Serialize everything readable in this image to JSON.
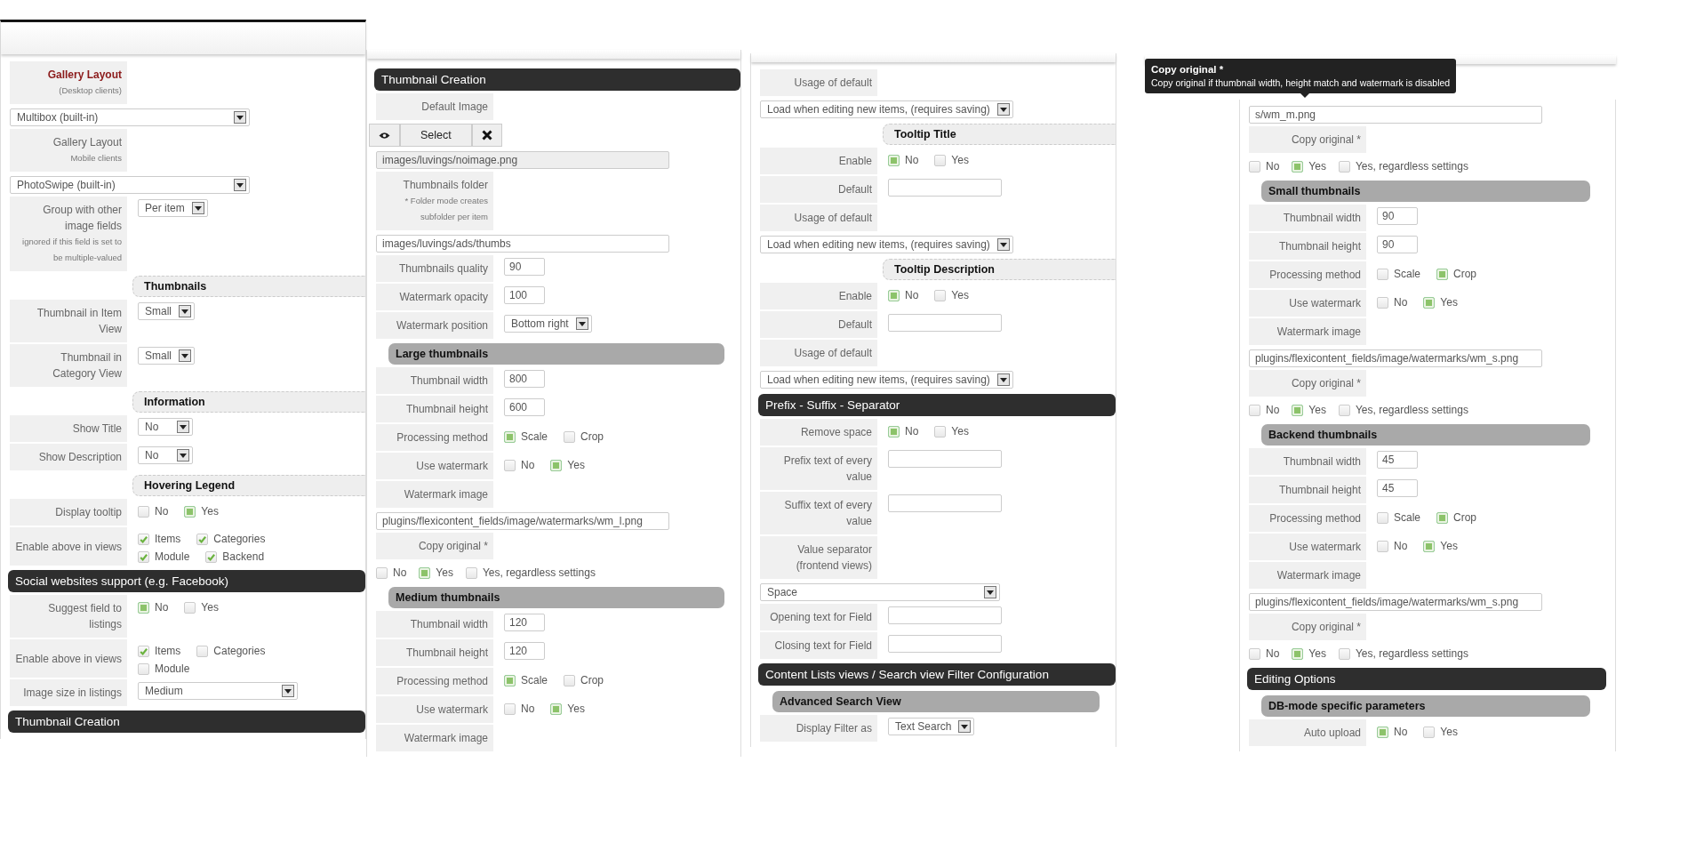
{
  "panels": [
    {
      "rows": [
        {
          "kind": "field",
          "label": "Gallery Layout",
          "note": "(Desktop clients)",
          "emphasized": true
        },
        {
          "kind": "select",
          "value": "Multibox (built-in)"
        },
        {
          "kind": "field",
          "label": "Gallery Layout",
          "note": "Mobile clients",
          "emphasized": false
        },
        {
          "kind": "select",
          "value": "PhotoSwipe (built-in)"
        },
        {
          "kind": "field",
          "label": "Group with other image fields",
          "note": "ignored if this field is set to be multiple-valued",
          "control": {
            "kind": "select",
            "value": "Per item"
          }
        },
        {
          "kind": "subheader",
          "text": "Thumbnails"
        },
        {
          "kind": "field",
          "label": "Thumbnail in Item View",
          "control": {
            "kind": "select",
            "value": "Small"
          }
        },
        {
          "kind": "field",
          "label": "Thumbnail in Category View",
          "control": {
            "kind": "select",
            "value": "Small"
          }
        },
        {
          "kind": "subheader",
          "text": "Information"
        },
        {
          "kind": "field",
          "label": "Show Title",
          "control": {
            "kind": "select",
            "value": "No"
          }
        },
        {
          "kind": "field",
          "label": "Show Description",
          "control": {
            "kind": "select",
            "value": "No"
          }
        },
        {
          "kind": "subheader",
          "text": "Hovering Legend"
        },
        {
          "kind": "field",
          "label": "Display tooltip",
          "control": {
            "kind": "radio",
            "options": [
              {
                "text": "No",
                "selected": false
              },
              {
                "text": "Yes",
                "selected": true
              }
            ]
          }
        },
        {
          "kind": "field",
          "label": "Enable above in views",
          "control": {
            "kind": "checks",
            "options": [
              {
                "text": "Items",
                "checked": true
              },
              {
                "text": "Categories",
                "checked": true
              },
              {
                "text": "Module",
                "checked": true
              },
              {
                "text": "Backend",
                "checked": true
              }
            ]
          }
        },
        {
          "kind": "header",
          "text": "Social websites support (e.g. Facebook)"
        },
        {
          "kind": "field",
          "label": "Suggest field to listings",
          "control": {
            "kind": "radio",
            "options": [
              {
                "text": "No",
                "selected": true
              },
              {
                "text": "Yes",
                "selected": false
              }
            ]
          }
        },
        {
          "kind": "field",
          "label": "Enable above in views",
          "control": {
            "kind": "checks",
            "options": [
              {
                "text": "Items",
                "checked": true
              },
              {
                "text": "Categories",
                "checked": false
              },
              {
                "text": "Module",
                "checked": false
              }
            ]
          }
        },
        {
          "kind": "field",
          "label": "Image size in listings",
          "control": {
            "kind": "wide_select",
            "value": "Medium"
          }
        },
        {
          "kind": "header",
          "text": "Thumbnail Creation"
        }
      ]
    },
    {
      "rows": [
        {
          "kind": "header",
          "text": "Thumbnail Creation"
        },
        {
          "kind": "field",
          "label": "Default Image"
        },
        {
          "kind": "image_buttons",
          "text": "Select"
        },
        {
          "kind": "path",
          "value": "images/luvings/noimage.png",
          "readonly": true
        },
        {
          "kind": "field",
          "label": "Thumbnails folder",
          "note": "* Folder mode creates subfolder per item"
        },
        {
          "kind": "path",
          "value": "images/luvings/ads/thumbs",
          "readonly": false
        },
        {
          "kind": "field",
          "label": "Thumbnails quality",
          "control": {
            "kind": "input",
            "value": "90"
          }
        },
        {
          "kind": "field",
          "label": "Watermark opacity",
          "control": {
            "kind": "input",
            "value": "100"
          }
        },
        {
          "kind": "field",
          "label": "Watermark position",
          "control": {
            "kind": "select",
            "value": "Bottom right"
          }
        },
        {
          "kind": "group",
          "text": "Large thumbnails"
        },
        {
          "kind": "field",
          "label": "Thumbnail width",
          "control": {
            "kind": "input",
            "value": "800"
          }
        },
        {
          "kind": "field",
          "label": "Thumbnail height",
          "control": {
            "kind": "input",
            "value": "600"
          }
        },
        {
          "kind": "field",
          "label": "Processing method",
          "control": {
            "kind": "radio",
            "options": [
              {
                "text": "Scale",
                "selected": true
              },
              {
                "text": "Crop",
                "selected": false
              }
            ]
          }
        },
        {
          "kind": "field",
          "label": "Use watermark",
          "control": {
            "kind": "radio",
            "options": [
              {
                "text": "No",
                "selected": false
              },
              {
                "text": "Yes",
                "selected": true
              }
            ]
          }
        },
        {
          "kind": "field",
          "label": "Watermark image"
        },
        {
          "kind": "path",
          "value": "plugins/flexicontent_fields/image/watermarks/wm_l.png"
        },
        {
          "kind": "field",
          "label": "Copy original *"
        },
        {
          "kind": "choices",
          "options": [
            {
              "text": "No",
              "selected": false
            },
            {
              "text": "Yes",
              "selected": true
            },
            {
              "text": "Yes, regardless settings",
              "selected": false
            }
          ]
        },
        {
          "kind": "group",
          "text": "Medium thumbnails"
        },
        {
          "kind": "field",
          "label": "Thumbnail width",
          "control": {
            "kind": "input",
            "value": "120"
          }
        },
        {
          "kind": "field",
          "label": "Thumbnail height",
          "control": {
            "kind": "input",
            "value": "120"
          }
        },
        {
          "kind": "field",
          "label": "Processing method",
          "control": {
            "kind": "radio",
            "options": [
              {
                "text": "Scale",
                "selected": true
              },
              {
                "text": "Crop",
                "selected": false
              }
            ]
          }
        },
        {
          "kind": "field",
          "label": "Use watermark",
          "control": {
            "kind": "radio",
            "options": [
              {
                "text": "No",
                "selected": false
              },
              {
                "text": "Yes",
                "selected": true
              }
            ]
          }
        },
        {
          "kind": "field",
          "label": "Watermark image"
        }
      ]
    },
    {
      "rows": [
        {
          "kind": "field",
          "label": "Usage of default"
        },
        {
          "kind": "select",
          "value": "Load when editing new items, (requires saving)"
        },
        {
          "kind": "subheader",
          "text": "Tooltip Title"
        },
        {
          "kind": "field",
          "label": "Enable",
          "control": {
            "kind": "radio",
            "options": [
              {
                "text": "No",
                "selected": true
              },
              {
                "text": "Yes",
                "selected": false
              }
            ]
          }
        },
        {
          "kind": "field",
          "label": "Default",
          "control": {
            "kind": "input"
          }
        },
        {
          "kind": "field",
          "label": "Usage of default"
        },
        {
          "kind": "select",
          "value": "Load when editing new items, (requires saving)"
        },
        {
          "kind": "subheader",
          "text": "Tooltip Description"
        },
        {
          "kind": "field",
          "label": "Enable",
          "control": {
            "kind": "radio",
            "options": [
              {
                "text": "No",
                "selected": true
              },
              {
                "text": "Yes",
                "selected": false
              }
            ]
          }
        },
        {
          "kind": "field",
          "label": "Default",
          "control": {
            "kind": "input"
          }
        },
        {
          "kind": "field",
          "label": "Usage of default"
        },
        {
          "kind": "select",
          "value": "Load when editing new items, (requires saving)"
        },
        {
          "kind": "header",
          "text": "Prefix - Suffix - Separator"
        },
        {
          "kind": "field",
          "label": "Remove space",
          "control": {
            "kind": "radio",
            "options": [
              {
                "text": "No",
                "selected": true
              },
              {
                "text": "Yes",
                "selected": false
              }
            ]
          }
        },
        {
          "kind": "field",
          "label": "Prefix text of every value",
          "control": {
            "kind": "input"
          }
        },
        {
          "kind": "field",
          "label": "Suffix text of every value",
          "control": {
            "kind": "input"
          }
        },
        {
          "kind": "field",
          "label": "Value separator (frontend views)"
        },
        {
          "kind": "select",
          "value": "Space"
        },
        {
          "kind": "field",
          "label": "Opening text for Field",
          "control": {
            "kind": "input"
          }
        },
        {
          "kind": "field",
          "label": "Closing text for Field",
          "control": {
            "kind": "input"
          }
        },
        {
          "kind": "header",
          "text": "Content Lists views / Search view Filter Configuration"
        },
        {
          "kind": "group",
          "text": "Advanced Search View"
        },
        {
          "kind": "field",
          "label": "Display Filter as",
          "control": {
            "kind": "select",
            "value": "Text Search"
          }
        }
      ]
    },
    {
      "tooltip": {
        "title": "Copy original *",
        "text": "Copy original if thumbnail width, height match and watermark is disabled"
      },
      "rows": [
        {
          "kind": "path",
          "value": "s/wm_m.png"
        },
        {
          "kind": "field",
          "label": "Copy original *"
        },
        {
          "kind": "choices",
          "options": [
            {
              "text": "No",
              "selected": false
            },
            {
              "text": "Yes",
              "selected": true
            },
            {
              "text": "Yes, regardless settings",
              "selected": false
            }
          ]
        },
        {
          "kind": "group",
          "text": "Small thumbnails"
        },
        {
          "kind": "field",
          "label": "Thumbnail width",
          "control": {
            "kind": "input",
            "value": "90"
          }
        },
        {
          "kind": "field",
          "label": "Thumbnail height",
          "control": {
            "kind": "input",
            "value": "90"
          }
        },
        {
          "kind": "field",
          "label": "Processing method",
          "control": {
            "kind": "radio",
            "options": [
              {
                "text": "Scale",
                "selected": false
              },
              {
                "text": "Crop",
                "selected": true
              }
            ]
          }
        },
        {
          "kind": "field",
          "label": "Use watermark",
          "control": {
            "kind": "radio",
            "options": [
              {
                "text": "No",
                "selected": false
              },
              {
                "text": "Yes",
                "selected": true
              }
            ]
          }
        },
        {
          "kind": "field",
          "label": "Watermark image"
        },
        {
          "kind": "path",
          "value": "plugins/flexicontent_fields/image/watermarks/wm_s.png"
        },
        {
          "kind": "field",
          "label": "Copy original *"
        },
        {
          "kind": "choices",
          "options": [
            {
              "text": "No",
              "selected": false
            },
            {
              "text": "Yes",
              "selected": true
            },
            {
              "text": "Yes, regardless settings",
              "selected": false
            }
          ]
        },
        {
          "kind": "group",
          "text": "Backend thumbnails"
        },
        {
          "kind": "field",
          "label": "Thumbnail width",
          "control": {
            "kind": "input",
            "value": "45"
          }
        },
        {
          "kind": "field",
          "label": "Thumbnail height",
          "control": {
            "kind": "input",
            "value": "45"
          }
        },
        {
          "kind": "field",
          "label": "Processing method",
          "control": {
            "kind": "radio",
            "options": [
              {
                "text": "Scale",
                "selected": false
              },
              {
                "text": "Crop",
                "selected": true
              }
            ]
          }
        },
        {
          "kind": "field",
          "label": "Use watermark",
          "control": {
            "kind": "radio",
            "options": [
              {
                "text": "No",
                "selected": false
              },
              {
                "text": "Yes",
                "selected": true
              }
            ]
          }
        },
        {
          "kind": "field",
          "label": "Watermark image"
        },
        {
          "kind": "path",
          "value": "plugins/flexicontent_fields/image/watermarks/wm_s.png"
        },
        {
          "kind": "field",
          "label": "Copy original *"
        },
        {
          "kind": "choices",
          "options": [
            {
              "text": "No",
              "selected": false
            },
            {
              "text": "Yes",
              "selected": true
            },
            {
              "text": "Yes, regardless settings",
              "selected": false
            }
          ]
        },
        {
          "kind": "header",
          "text": "Editing Options"
        },
        {
          "kind": "group",
          "text": "DB-mode specific parameters"
        },
        {
          "kind": "field",
          "label": "Auto upload",
          "control": {
            "kind": "radio",
            "options": [
              {
                "text": "No",
                "selected": true
              },
              {
                "text": "Yes",
                "selected": false
              }
            ]
          }
        }
      ]
    }
  ]
}
